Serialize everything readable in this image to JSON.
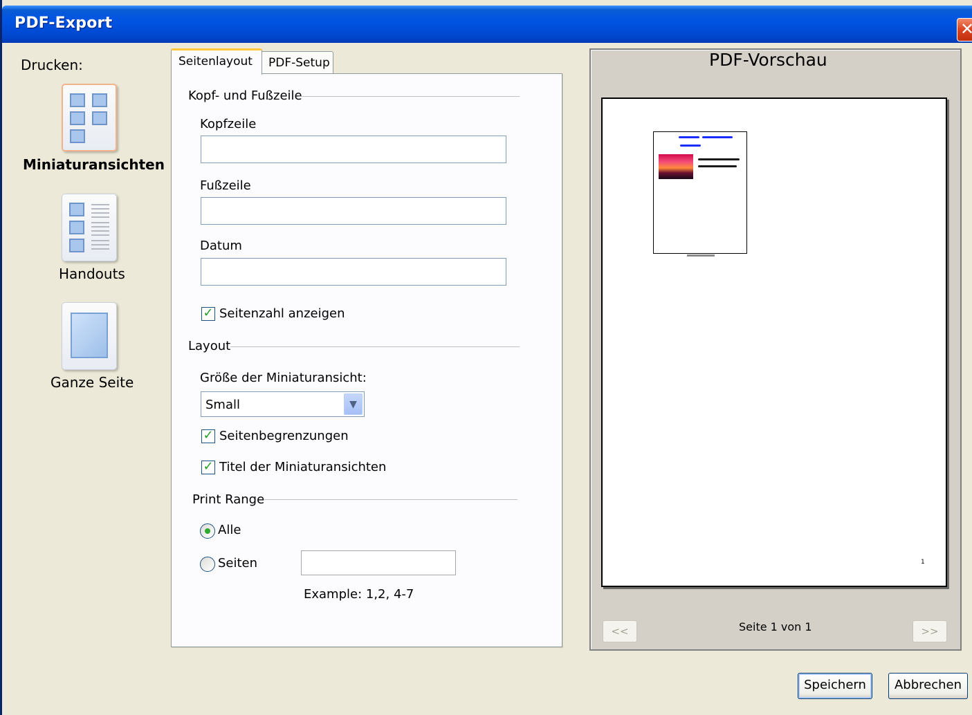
{
  "window": {
    "title": "PDF-Export",
    "close_symbol": "✕"
  },
  "print": {
    "heading": "Drucken:",
    "options": [
      {
        "label": "Miniaturansichten",
        "selected": true,
        "icon": "thumbnails-icon"
      },
      {
        "label": "Handouts",
        "selected": false,
        "icon": "handouts-icon"
      },
      {
        "label": "Ganze Seite",
        "selected": false,
        "icon": "full-page-icon"
      }
    ]
  },
  "tabs": [
    {
      "label": "Seitenlayout",
      "active": true
    },
    {
      "label": "PDF-Setup",
      "active": false
    }
  ],
  "header_footer": {
    "section_label": "Kopf- und Fußzeile",
    "header_label": "Kopfzeile",
    "header_value": "",
    "footer_label": "Fußzeile",
    "footer_value": "",
    "date_label": "Datum",
    "date_value": "",
    "page_number_label": "Seitenzahl anzeigen",
    "page_number_checked": true
  },
  "layout": {
    "section_label": "Layout",
    "size_label": "Größe der Miniaturansicht:",
    "size_value": "Small",
    "borders_label": "Seitenbegrenzungen",
    "borders_checked": true,
    "titles_label": "Titel der Miniaturansichten",
    "titles_checked": true
  },
  "print_range": {
    "section_label": "Print Range",
    "all_label": "Alle",
    "pages_label": "Seiten",
    "selected": "all",
    "pages_value": "",
    "example": "Example:  1,2, 4-7"
  },
  "preview": {
    "title": "PDF-Vorschau",
    "page_status": "Seite 1 von 1",
    "prev_label": "<<",
    "next_label": ">>",
    "page_number": "1"
  },
  "buttons": {
    "save": "Speichern",
    "cancel": "Abbrechen"
  },
  "colors": {
    "titlebar": "#0054e3",
    "check": "#21a121",
    "tab_highlight": "#ffc83c"
  }
}
